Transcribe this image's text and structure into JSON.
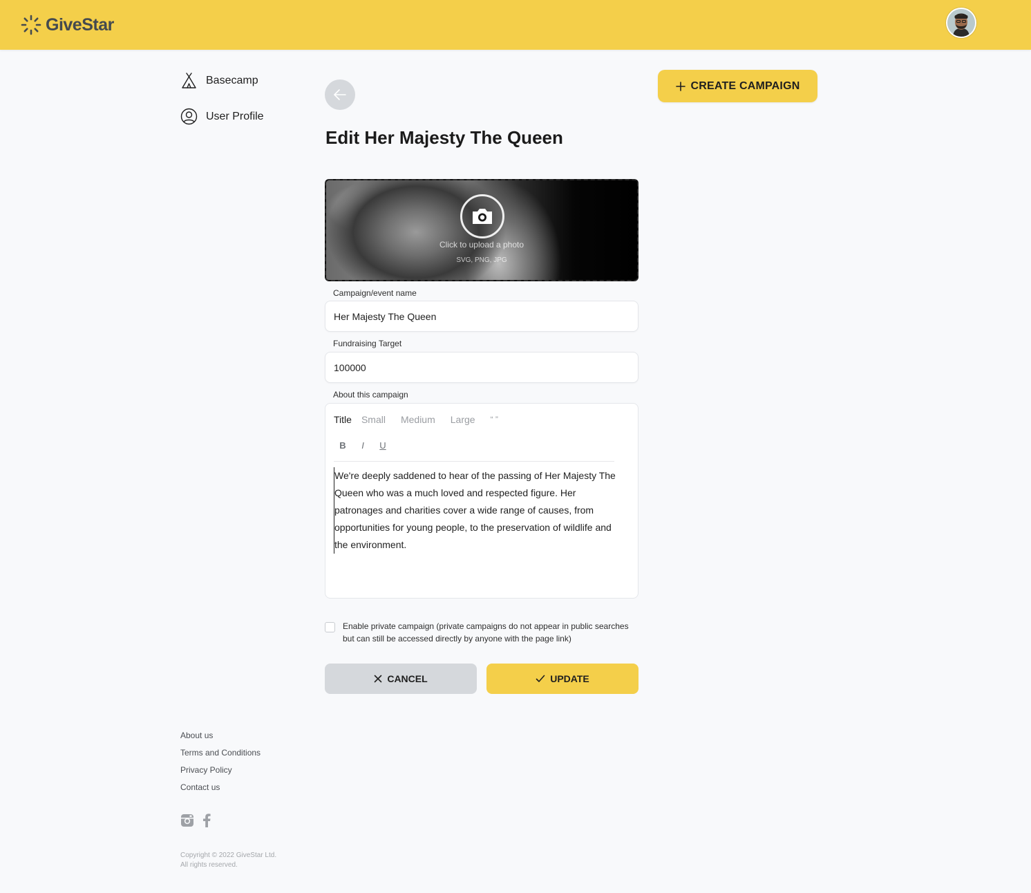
{
  "brand": {
    "name": "GiveStar",
    "accent": "#f4cf4a"
  },
  "header": {
    "avatar_icon": "user-avatar"
  },
  "sidebar": {
    "items": [
      {
        "label": "Basecamp",
        "icon": "tent-icon"
      },
      {
        "label": "User Profile",
        "icon": "user-circle-icon"
      }
    ]
  },
  "actions": {
    "create_campaign_label": "CREATE CAMPAIGN"
  },
  "page": {
    "title": "Edit Her Majesty The Queen"
  },
  "uploader": {
    "label": "Click to upload a photo",
    "sub": "SVG, PNG, JPG"
  },
  "form": {
    "name_label": "Campaign/event name",
    "name_value": "Her Majesty The Queen",
    "target_label": "Fundraising Target",
    "target_value": "100000",
    "about_label": "About this campaign",
    "editor": {
      "styles": [
        "Title",
        "Small",
        "Medium",
        "Large",
        "“ ”"
      ],
      "formats": [
        "B",
        "I",
        "U"
      ],
      "body": "We're deeply saddened to hear of the passing of Her Majesty The Queen who was a much loved and respected figure. Her patronages and charities cover a wide range of causes, from opportunities for young people, to the preservation of wildlife and the environment."
    },
    "private_label": "Enable private campaign (private campaigns do not appear in public searches but can still be accessed directly by anyone with the page link)",
    "private_checked": false,
    "cancel_label": "CANCEL",
    "update_label": "UPDATE"
  },
  "footer": {
    "links": [
      "About us",
      "Terms and Conditions",
      "Privacy Policy",
      "Contact us"
    ],
    "social": [
      "instagram-icon",
      "facebook-icon"
    ],
    "copyright": "Copyright © 2022 GiveStar Ltd. All rights reserved."
  }
}
